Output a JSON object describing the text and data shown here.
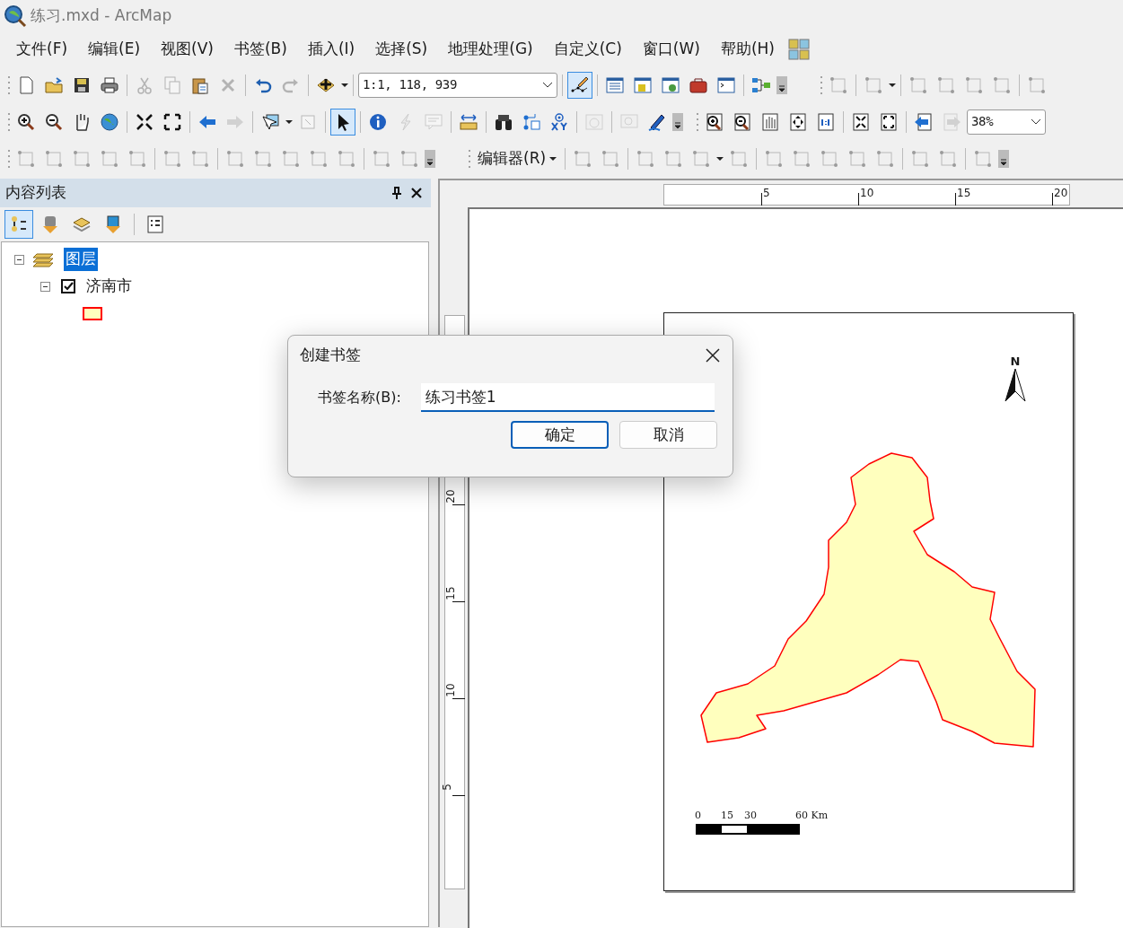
{
  "window": {
    "title": "练习.mxd - ArcMap"
  },
  "menu": [
    {
      "label": "文件(F)"
    },
    {
      "label": "编辑(E)"
    },
    {
      "label": "视图(V)"
    },
    {
      "label": "书签(B)"
    },
    {
      "label": "插入(I)"
    },
    {
      "label": "选择(S)"
    },
    {
      "label": "地理处理(G)"
    },
    {
      "label": "自定义(C)"
    },
    {
      "label": "窗口(W)"
    },
    {
      "label": "帮助(H)"
    }
  ],
  "toolbars": [
    {
      "groups": [
        [
          {
            "kind": "tool",
            "disabled": false,
            "selected": false
          },
          {
            "kind": "tool",
            "disabled": false,
            "selected": false
          },
          {
            "kind": "tool",
            "disabled": false,
            "selected": false
          },
          {
            "kind": "tool",
            "disabled": false,
            "selected": false
          },
          {
            "kind": "sep"
          },
          {
            "kind": "tool",
            "disabled": true,
            "selected": false
          },
          {
            "kind": "tool",
            "disabled": true,
            "selected": false
          },
          {
            "kind": "tool",
            "disabled": false,
            "selected": false
          },
          {
            "kind": "tool",
            "disabled": true,
            "selected": false
          },
          {
            "kind": "sep"
          },
          {
            "kind": "tool",
            "disabled": false,
            "selected": false
          },
          {
            "kind": "tool",
            "disabled": true,
            "selected": false
          },
          {
            "kind": "sep"
          },
          {
            "kind": "tool",
            "disabled": false,
            "selected": false
          },
          {
            "kind": "caret"
          },
          {
            "kind": "sep"
          },
          {
            "kind": "combo",
            "value": "1:1, 118, 939"
          },
          {
            "kind": "sep"
          },
          {
            "kind": "tool",
            "disabled": false,
            "selected": true
          },
          {
            "kind": "sep"
          },
          {
            "kind": "tool",
            "disabled": false,
            "selected": false
          },
          {
            "kind": "tool",
            "disabled": false,
            "selected": false
          },
          {
            "kind": "tool",
            "disabled": false,
            "selected": false
          },
          {
            "kind": "tool",
            "disabled": false,
            "selected": false
          },
          {
            "kind": "tool",
            "disabled": false,
            "selected": false
          },
          {
            "kind": "sep"
          },
          {
            "kind": "tool",
            "disabled": false,
            "selected": false
          },
          {
            "kind": "overflow"
          }
        ],
        [
          {
            "kind": "tool",
            "disabled": true,
            "selected": false
          },
          {
            "kind": "sep"
          },
          {
            "kind": "tool",
            "disabled": true,
            "selected": false
          },
          {
            "kind": "caret"
          },
          {
            "kind": "sep"
          },
          {
            "kind": "tool",
            "disabled": true,
            "selected": false
          },
          {
            "kind": "tool",
            "disabled": true,
            "selected": false
          },
          {
            "kind": "tool",
            "disabled": true,
            "selected": false
          },
          {
            "kind": "tool",
            "disabled": true,
            "selected": false
          },
          {
            "kind": "sep"
          },
          {
            "kind": "tool",
            "disabled": true,
            "selected": false
          }
        ]
      ]
    },
    {
      "groups": [
        [
          {
            "kind": "tool",
            "disabled": false,
            "selected": false
          },
          {
            "kind": "tool",
            "disabled": false,
            "selected": false
          },
          {
            "kind": "tool",
            "disabled": false,
            "selected": false
          },
          {
            "kind": "tool",
            "disabled": false,
            "selected": false
          },
          {
            "kind": "sep"
          },
          {
            "kind": "tool",
            "disabled": false,
            "selected": false
          },
          {
            "kind": "tool",
            "disabled": false,
            "selected": false
          },
          {
            "kind": "sep"
          },
          {
            "kind": "tool",
            "disabled": false,
            "selected": false
          },
          {
            "kind": "tool",
            "disabled": true,
            "selected": false
          },
          {
            "kind": "sep"
          },
          {
            "kind": "tool",
            "disabled": false,
            "selected": false
          },
          {
            "kind": "caret"
          },
          {
            "kind": "tool",
            "disabled": true,
            "selected": false
          },
          {
            "kind": "sep"
          },
          {
            "kind": "tool",
            "disabled": false,
            "selected": true
          },
          {
            "kind": "sep"
          },
          {
            "kind": "tool",
            "disabled": false,
            "selected": false
          },
          {
            "kind": "tool",
            "disabled": true,
            "selected": false
          },
          {
            "kind": "tool",
            "disabled": true,
            "selected": false
          },
          {
            "kind": "sep"
          },
          {
            "kind": "tool",
            "disabled": false,
            "selected": false
          },
          {
            "kind": "sep"
          },
          {
            "kind": "tool",
            "disabled": false,
            "selected": false
          },
          {
            "kind": "tool",
            "disabled": false,
            "selected": false
          },
          {
            "kind": "tool",
            "disabled": false,
            "selected": false
          },
          {
            "kind": "sep"
          },
          {
            "kind": "tool",
            "disabled": true,
            "selected": false
          },
          {
            "kind": "sep"
          },
          {
            "kind": "tool",
            "disabled": true,
            "selected": false
          },
          {
            "kind": "tool",
            "disabled": false,
            "selected": false
          },
          {
            "kind": "overflow"
          }
        ],
        [
          {
            "kind": "tool",
            "disabled": false,
            "selected": false
          },
          {
            "kind": "tool",
            "disabled": false,
            "selected": false
          },
          {
            "kind": "tool",
            "disabled": false,
            "selected": false
          },
          {
            "kind": "tool",
            "disabled": false,
            "selected": false
          },
          {
            "kind": "tool",
            "disabled": false,
            "selected": false
          },
          {
            "kind": "sep"
          },
          {
            "kind": "tool",
            "disabled": false,
            "selected": false
          },
          {
            "kind": "tool",
            "disabled": false,
            "selected": false
          },
          {
            "kind": "sep"
          },
          {
            "kind": "tool",
            "disabled": false,
            "selected": false
          },
          {
            "kind": "tool",
            "disabled": true,
            "selected": false
          },
          {
            "kind": "combo",
            "value": "38%"
          }
        ]
      ]
    },
    {
      "groups": [
        [
          {
            "kind": "tool",
            "disabled": true,
            "selected": false
          },
          {
            "kind": "tool",
            "disabled": true,
            "selected": false
          },
          {
            "kind": "tool",
            "disabled": true,
            "selected": false
          },
          {
            "kind": "tool",
            "disabled": true,
            "selected": false
          },
          {
            "kind": "tool",
            "disabled": true,
            "selected": false
          },
          {
            "kind": "sep"
          },
          {
            "kind": "tool",
            "disabled": true,
            "selected": false
          },
          {
            "kind": "tool",
            "disabled": true,
            "selected": false
          },
          {
            "kind": "sep"
          },
          {
            "kind": "tool",
            "disabled": true,
            "selected": false
          },
          {
            "kind": "tool",
            "disabled": true,
            "selected": false
          },
          {
            "kind": "tool",
            "disabled": true,
            "selected": false
          },
          {
            "kind": "tool",
            "disabled": true,
            "selected": false
          },
          {
            "kind": "tool",
            "disabled": true,
            "selected": false
          },
          {
            "kind": "sep"
          },
          {
            "kind": "tool",
            "disabled": true,
            "selected": false
          },
          {
            "kind": "tool",
            "disabled": true,
            "selected": false
          },
          {
            "kind": "overflow"
          }
        ],
        [
          {
            "kind": "menu",
            "label": "编辑器(R)"
          },
          {
            "kind": "sep"
          },
          {
            "kind": "tool",
            "disabled": true,
            "selected": false
          },
          {
            "kind": "tool",
            "disabled": true,
            "selected": false
          },
          {
            "kind": "sep"
          },
          {
            "kind": "tool",
            "disabled": true,
            "selected": false
          },
          {
            "kind": "tool",
            "disabled": true,
            "selected": false
          },
          {
            "kind": "tool",
            "disabled": true,
            "selected": false
          },
          {
            "kind": "caret"
          },
          {
            "kind": "tool",
            "disabled": true,
            "selected": false
          },
          {
            "kind": "sep"
          },
          {
            "kind": "tool",
            "disabled": true,
            "selected": false
          },
          {
            "kind": "tool",
            "disabled": true,
            "selected": false
          },
          {
            "kind": "tool",
            "disabled": true,
            "selected": false
          },
          {
            "kind": "tool",
            "disabled": true,
            "selected": false
          },
          {
            "kind": "tool",
            "disabled": true,
            "selected": false
          },
          {
            "kind": "sep"
          },
          {
            "kind": "tool",
            "disabled": true,
            "selected": false
          },
          {
            "kind": "tool",
            "disabled": true,
            "selected": false
          },
          {
            "kind": "sep"
          },
          {
            "kind": "tool",
            "disabled": true,
            "selected": false
          },
          {
            "kind": "overflow"
          }
        ]
      ]
    }
  ],
  "toc": {
    "title": "内容列表",
    "view_buttons": [
      {
        "selected": true
      },
      {
        "selected": false
      },
      {
        "selected": false
      },
      {
        "selected": false
      },
      {
        "selected": false
      }
    ],
    "tree": [
      {
        "label": "图层",
        "selected": true,
        "expanded": true,
        "children": [
          {
            "label": "济南市",
            "checked": true,
            "expanded": true
          }
        ]
      }
    ]
  },
  "layout": {
    "top_ruler": [
      "5",
      "10",
      "15",
      "20"
    ],
    "side_ruler": [
      "20",
      "15",
      "10",
      "5"
    ],
    "north_arrow": "N",
    "scale_bar": [
      "0",
      "15",
      "30",
      "60 Km"
    ]
  },
  "dialog": {
    "title": "创建书签",
    "field_label": "书签名称(B):",
    "value": "练习书签1",
    "buttons": [
      {
        "label": "确定",
        "default": true
      },
      {
        "label": "取消",
        "default": false
      }
    ]
  }
}
